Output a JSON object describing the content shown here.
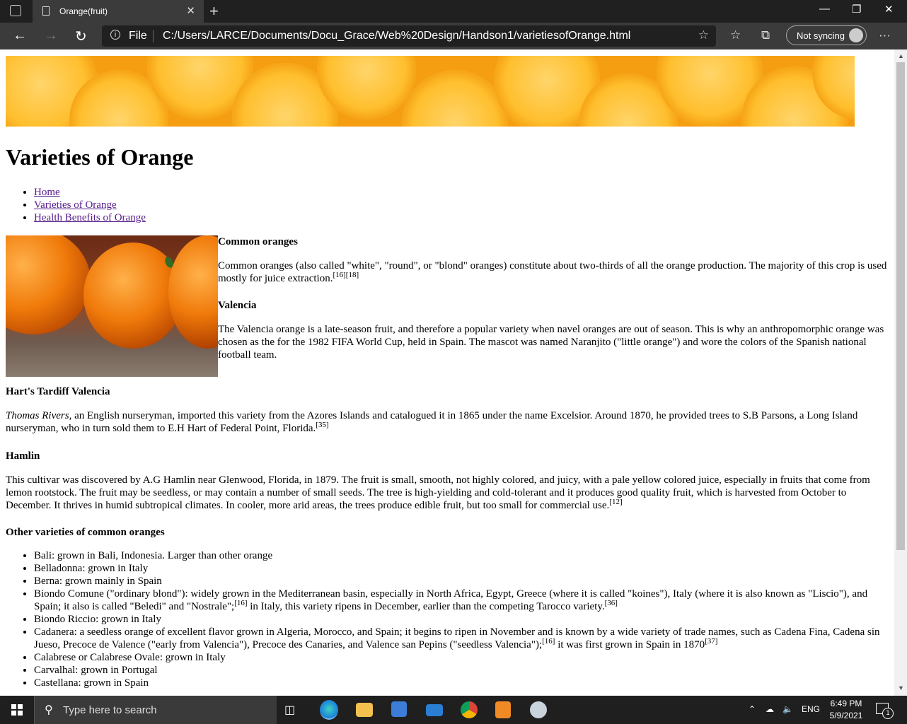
{
  "browser": {
    "tab_title": "Orange(fruit)",
    "tab_close": "✕",
    "new_tab": "+",
    "scheme_label": "File",
    "url": "C:/Users/LARCE/Documents/Docu_Grace/Web%20Design/Handson1/varietiesofOrange.html",
    "sync_label": "Not syncing",
    "window_controls": {
      "minimize": "—",
      "restore": "❐",
      "close": "✕"
    },
    "more_menu": "···"
  },
  "page": {
    "heading": "Varieties of Orange",
    "nav": [
      "Home",
      "Varieties of Orange",
      "Health Benefits of Orange"
    ],
    "sections": {
      "common": {
        "title": "Common oranges",
        "text": "Common oranges (also called \"white\", \"round\", or \"blond\" oranges) constitute about two-thirds of all the orange production. The majority of this crop is used mostly for juice extraction.",
        "refs": "[16][18]"
      },
      "valencia": {
        "title": "Valencia",
        "text": "The Valencia orange is a late-season fruit, and therefore a popular variety when navel oranges are out of season. This is why an anthropomorphic orange was chosen as the for the 1982 FIFA World Cup, held in Spain. The mascot was named Naranjito (\"little orange\") and wore the colors of the Spanish national football team."
      },
      "harts": {
        "title": "Hart's Tardiff Valencia",
        "italic": "Thomas Rivers,",
        "text": " an English nurseryman, imported this variety from the Azores Islands and catalogued it in 1865 under the name Excelsior. Around 1870, he provided trees to S.B Parsons, a Long Island nurseryman, who in turn sold them to E.H Hart of Federal Point, Florida.",
        "refs": "[35]"
      },
      "hamlin": {
        "title": "Hamlin",
        "text": "This cultivar was discovered by A.G Hamlin near Glenwood, Florida, in 1879. The fruit is small, smooth, not highly colored, and juicy, with a pale yellow colored juice, especially in fruits that come from lemon rootstock. The fruit may be seedless, or may contain a number of small seeds. The tree is high-yielding and cold-tolerant and it produces good quality fruit, which is harvested from October to December. It thrives in humid subtropical climates. In cooler, more arid areas, the trees produce edible fruit, but too small for commercial use.",
        "refs": "[12]"
      },
      "other": {
        "title": "Other varieties of common oranges"
      }
    },
    "varieties": {
      "bali": "Bali: grown in Bali, Indonesia. Larger than other orange",
      "belladonna": "Belladonna: grown in Italy",
      "berna": "Berna: grown mainly in Spain",
      "biondo_a": "Biondo Comune (\"ordinary blond\"): widely grown in the Mediterranean basin, especially in North Africa, Egypt, Greece (where it is called \"koines\"), Italy (where it is also known as \"Liscio\"), and Spain; it also is called \"Beledi\" and \"Nostrale\";",
      "biondo_ref1": "[16]",
      "biondo_b": " in Italy, this variety ripens in December, earlier than the competing Tarocco variety.",
      "biondo_ref2": "[36]",
      "riccio": "Biondo Riccio: grown in Italy",
      "cadanera_a": "Cadanera: a seedless orange of excellent flavor grown in Algeria, Morocco, and Spain; it begins to ripen in November and is known by a wide variety of trade names, such as Cadena Fina, Cadena sin Jueso, Precoce de Valence (\"early from Valencia\"), Precoce des Canaries, and Valence san Pepins (\"seedless Valencia\");",
      "cadanera_ref1": "[16]",
      "cadanera_b": " it was first grown in Spain in 1870",
      "cadanera_ref2": "[37]",
      "calabrese": "Calabrese or Calabrese Ovale: grown in Italy",
      "carvalhal": "Carvalhal: grown in Portugal",
      "castellana": "Castellana: grown in Spain"
    }
  },
  "taskbar": {
    "search_placeholder": "Type here to search",
    "lang": "ENG",
    "time": "6:49 PM",
    "date": "5/9/2021",
    "notification_count": "1"
  },
  "colors": {
    "visited_link": "#551a8b",
    "chrome_dark": "#202020",
    "chrome_bar": "#3b3b3b",
    "orange_banner": "#f59e12"
  }
}
